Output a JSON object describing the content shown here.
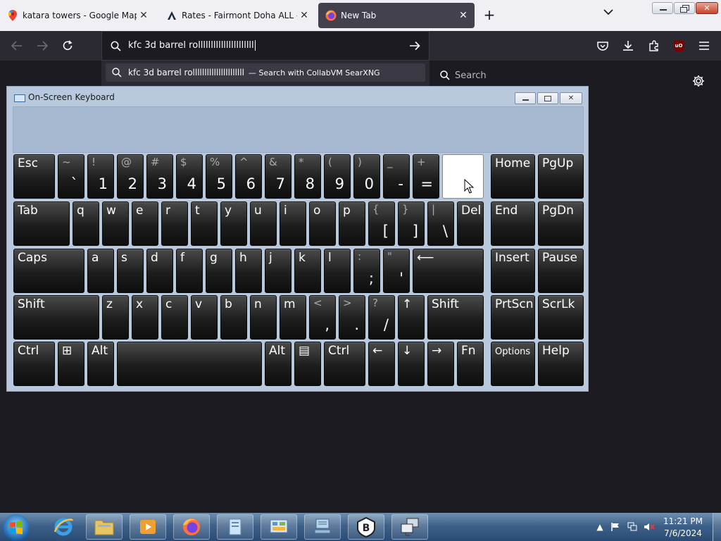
{
  "browser": {
    "tabs": [
      {
        "title": "katara towers - Google Maps",
        "active": false
      },
      {
        "title": "Rates - Fairmont Doha ALL - Ac",
        "active": false
      },
      {
        "title": "New Tab",
        "active": true
      }
    ],
    "url_value": "kfc 3d barrel rollllllllllllllllllllll",
    "search_placeholder": "Search",
    "suggestion": {
      "query": "kfc 3d barrel rollllllllllllllllllllll",
      "hint": "— Search with CollabVM SearXNG"
    }
  },
  "osk": {
    "title": "On-Screen Keyboard",
    "rows": [
      [
        {
          "k": "esc",
          "label": "Esc"
        },
        {
          "k": "backtick",
          "top": "~",
          "bot": "`"
        },
        {
          "k": "1",
          "top": "!",
          "bot": "1"
        },
        {
          "k": "2",
          "top": "@",
          "bot": "2"
        },
        {
          "k": "3",
          "top": "#",
          "bot": "3"
        },
        {
          "k": "4",
          "top": "$",
          "bot": "4"
        },
        {
          "k": "5",
          "top": "%",
          "bot": "5"
        },
        {
          "k": "6",
          "top": "^",
          "bot": "6"
        },
        {
          "k": "7",
          "top": "&",
          "bot": "7"
        },
        {
          "k": "8",
          "top": "*",
          "bot": "8"
        },
        {
          "k": "9",
          "top": "(",
          "bot": "9"
        },
        {
          "k": "0",
          "top": ")",
          "bot": "0"
        },
        {
          "k": "minus",
          "top": "_",
          "bot": "-"
        },
        {
          "k": "equals",
          "top": "+",
          "bot": "="
        },
        {
          "k": "backspace",
          "label": ""
        },
        {
          "k": "home",
          "label": "Home"
        },
        {
          "k": "pgup",
          "label": "PgUp"
        }
      ],
      [
        {
          "k": "tab",
          "label": "Tab"
        },
        {
          "k": "q",
          "label": "q"
        },
        {
          "k": "w",
          "label": "w"
        },
        {
          "k": "e",
          "label": "e"
        },
        {
          "k": "r",
          "label": "r"
        },
        {
          "k": "t",
          "label": "t"
        },
        {
          "k": "y",
          "label": "y"
        },
        {
          "k": "u",
          "label": "u"
        },
        {
          "k": "i",
          "label": "i"
        },
        {
          "k": "o",
          "label": "o"
        },
        {
          "k": "p",
          "label": "p"
        },
        {
          "k": "lbracket",
          "top": "{",
          "bot": "["
        },
        {
          "k": "rbracket",
          "top": "}",
          "bot": "]"
        },
        {
          "k": "backslash",
          "top": "|",
          "bot": "\\"
        },
        {
          "k": "del",
          "label": "Del"
        },
        {
          "k": "end",
          "label": "End"
        },
        {
          "k": "pgdn",
          "label": "PgDn"
        }
      ],
      [
        {
          "k": "caps",
          "label": "Caps"
        },
        {
          "k": "a",
          "label": "a"
        },
        {
          "k": "s",
          "label": "s"
        },
        {
          "k": "d",
          "label": "d"
        },
        {
          "k": "f",
          "label": "f"
        },
        {
          "k": "g",
          "label": "g"
        },
        {
          "k": "h",
          "label": "h"
        },
        {
          "k": "j",
          "label": "j"
        },
        {
          "k": "k",
          "label": "k"
        },
        {
          "k": "l",
          "label": "l"
        },
        {
          "k": "semicolon",
          "top": ":",
          "bot": ";"
        },
        {
          "k": "quote",
          "top": "\"",
          "bot": "'"
        },
        {
          "k": "enter",
          "label": "⟵"
        },
        {
          "k": "insert",
          "label": "Insert"
        },
        {
          "k": "pause",
          "label": "Pause"
        }
      ],
      [
        {
          "k": "lshift",
          "label": "Shift"
        },
        {
          "k": "z",
          "label": "z"
        },
        {
          "k": "x",
          "label": "x"
        },
        {
          "k": "c",
          "label": "c"
        },
        {
          "k": "v",
          "label": "v"
        },
        {
          "k": "b",
          "label": "b"
        },
        {
          "k": "n",
          "label": "n"
        },
        {
          "k": "m",
          "label": "m"
        },
        {
          "k": "comma",
          "top": "<",
          "bot": ","
        },
        {
          "k": "period",
          "top": ">",
          "bot": "."
        },
        {
          "k": "slash",
          "top": "?",
          "bot": "/"
        },
        {
          "k": "up",
          "label": "↑"
        },
        {
          "k": "rshift",
          "label": "Shift"
        },
        {
          "k": "prtscn",
          "label": "PrtScn"
        },
        {
          "k": "scrlk",
          "label": "ScrLk"
        }
      ],
      [
        {
          "k": "lctrl",
          "label": "Ctrl"
        },
        {
          "k": "win",
          "label": "⊞"
        },
        {
          "k": "lalt",
          "label": "Alt"
        },
        {
          "k": "space",
          "label": ""
        },
        {
          "k": "ralt",
          "label": "Alt"
        },
        {
          "k": "menu",
          "label": "▤"
        },
        {
          "k": "rctrl",
          "label": "Ctrl"
        },
        {
          "k": "left",
          "label": "←"
        },
        {
          "k": "down",
          "label": "↓"
        },
        {
          "k": "right",
          "label": "→"
        },
        {
          "k": "fn",
          "label": "Fn"
        },
        {
          "k": "options",
          "label": "Options"
        },
        {
          "k": "help",
          "label": "Help"
        }
      ]
    ]
  },
  "taskbar": {
    "time": "11:21 PM",
    "date": "7/6/2024",
    "apps": [
      "internet-explorer",
      "file-explorer",
      "media-player",
      "firefox",
      "generic-app",
      "control-panel",
      "network-app",
      "bitwarden",
      "remote-desktop"
    ]
  }
}
